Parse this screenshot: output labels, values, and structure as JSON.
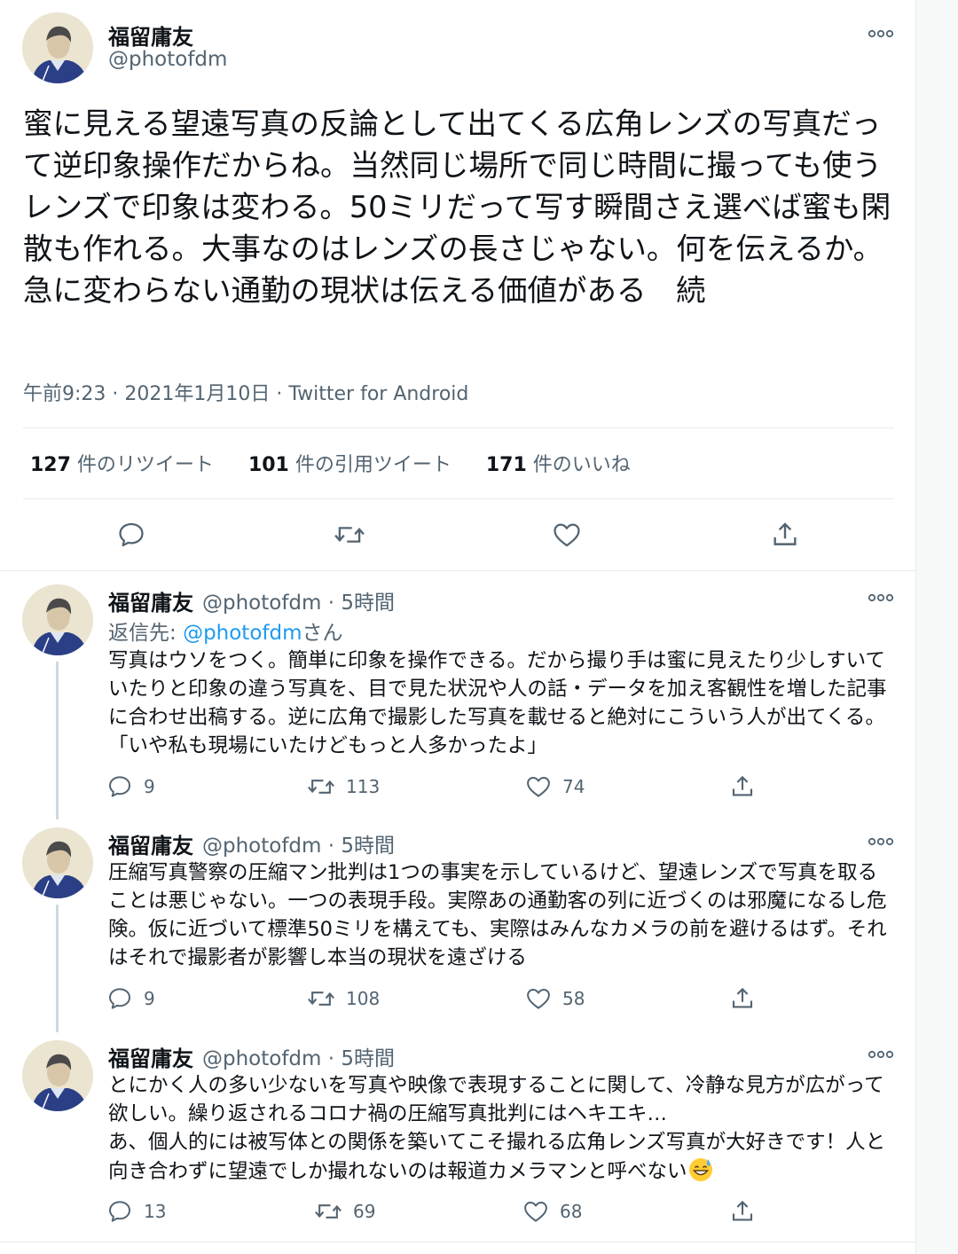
{
  "main_tweet": {
    "name": "福留庸友",
    "handle": "@photofdm",
    "text": "蜜に見える望遠写真の反論として出てくる広角レンズの写真だって逆印象操作だからね。当然同じ場所で同じ時間に撮っても使うレンズで印象は変わる。50ミリだって写す瞬間さえ選べば蜜も閑散も作れる。大事なのはレンズの長さじゃない。何を伝えるか。急に変わらない通勤の現状は伝える価値がある　続",
    "meta": "午前9:23 · 2021年1月10日 · Twitter for Android",
    "retweets_count": "127",
    "retweets_label": " 件のリツイート",
    "quotes_count": "101",
    "quotes_label": " 件の引用ツイート",
    "likes_count": "171",
    "likes_label": " 件のいいね"
  },
  "replies": [
    {
      "name": "福留庸友",
      "handle": "@photofdm · 5時間",
      "replying_prefix": "返信先: ",
      "replying_link": "@photofdm",
      "replying_suffix": "さん",
      "text": "写真はウソをつく。簡単に印象を操作できる。だから撮り手は蜜に見えたり少しすいていたりと印象の違う写真を、目で見た状況や人の話・データを加え客観性を増した記事に合わせ出稿する。逆に広角で撮影した写真を載せると絶対にこういう人が出てくる。「いや私も現場にいたけどもっと人多かったよ」",
      "replies": "9",
      "retweets": "113",
      "likes": "74"
    },
    {
      "name": "福留庸友",
      "handle": "@photofdm · 5時間",
      "text": "圧縮写真警察の圧縮マン批判は1つの事実を示しているけど、望遠レンズで写真を取ることは悪じゃない。一つの表現手段。実際あの通勤客の列に近づくのは邪魔になるし危険。仮に近づいて標準50ミリを構えても、実際はみんなカメラの前を避けるはず。それはそれで撮影者が影響し本当の現状を遠ざける",
      "replies": "9",
      "retweets": "108",
      "likes": "58"
    },
    {
      "name": "福留庸友",
      "handle": "@photofdm · 5時間",
      "text_line1": "とにかく人の多い少ないを写真や映像で表現することに関して、冷静な見方が広がって欲しい。繰り返されるコロナ禍の圧縮写真批判にはヘキエキ…",
      "text_line2": "あ、個人的には被写体との関係を築いてこそ撮れる広角レンズ写真が大好きです！人と向き合わずに望遠でしか撮れないのは報道カメラマンと呼べない",
      "emoji": "grinning-sweat-emoji",
      "replies": "13",
      "retweets": "69",
      "likes": "68"
    }
  ],
  "icons": {
    "reply": "reply-icon",
    "retweet": "retweet-icon",
    "like": "heart-icon",
    "share": "share-icon",
    "more": "more-icon"
  },
  "colors": {
    "link": "#1d9bf0",
    "secondary_text": "#536471",
    "divider": "#e6ecf0"
  }
}
